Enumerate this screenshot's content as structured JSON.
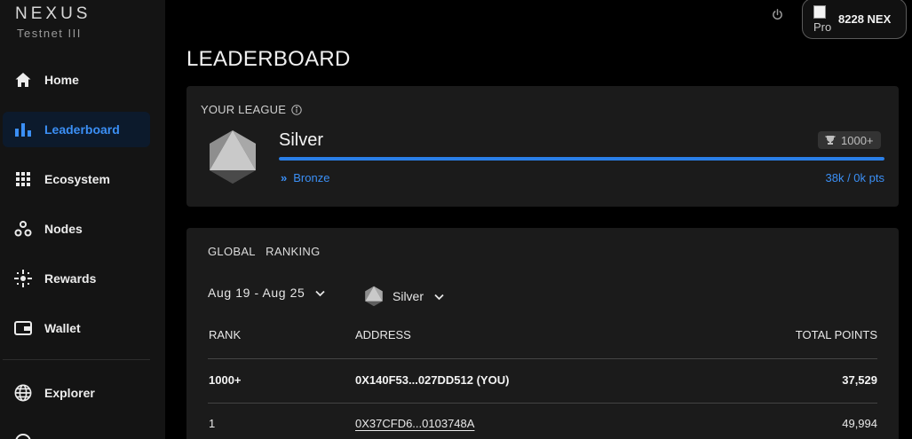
{
  "brand": {
    "name": "NEXUS",
    "subtitle": "Testnet III"
  },
  "sidebar": {
    "items": [
      {
        "label": "Home",
        "icon": "home-icon"
      },
      {
        "label": "Leaderboard",
        "icon": "bar-chart-icon",
        "active": true
      },
      {
        "label": "Ecosystem",
        "icon": "grid-icon"
      },
      {
        "label": "Nodes",
        "icon": "nodes-icon"
      },
      {
        "label": "Rewards",
        "icon": "sparkle-icon"
      },
      {
        "label": "Wallet",
        "icon": "wallet-icon"
      },
      {
        "label": "Explorer",
        "icon": "globe-icon"
      }
    ]
  },
  "topbar": {
    "power_icon": "power-icon",
    "profile": {
      "avatar_alt": "Pro",
      "balance": "8228 NEX"
    }
  },
  "page": {
    "title": "LEADERBOARD"
  },
  "league": {
    "label": "YOUR LEAGUE",
    "name": "Silver",
    "rank_badge": "1000+",
    "progress_fraction": 1.0,
    "previous_league": "Bronze",
    "points_progress": "38k / 0k pts"
  },
  "ranking": {
    "title": "GLOBAL  RANKING",
    "week_filter": "Aug 19 - Aug 25",
    "league_filter": "Silver",
    "columns": {
      "rank": "RANK",
      "address": "ADDRESS",
      "points": "TOTAL POINTS"
    },
    "rows": [
      {
        "rank": "1000+",
        "address": "0X140F53...027DD512 (YOU)",
        "points": "37,529",
        "is_you": true
      },
      {
        "rank": "1",
        "address": "0X37CFD6...0103748A",
        "points": "49,994",
        "is_you": false
      }
    ]
  },
  "colors": {
    "accent": "#2a7fe8",
    "background": "#000000",
    "sidebar": "#141414",
    "card": "#1b1b1b"
  }
}
